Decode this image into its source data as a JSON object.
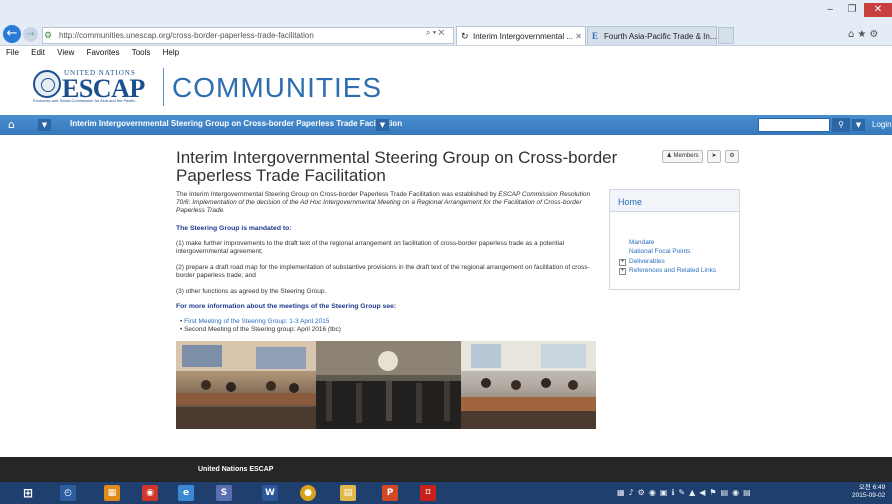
{
  "browser": {
    "address": "http://communities.unescap.org/cross-border-paperless-trade-facilitation",
    "address_controls": "⌕ ▾ ✕",
    "tabs": [
      {
        "label": "Interim Intergovernmental ...",
        "active": true
      },
      {
        "label": "Fourth Asia-Pacific Trade & In...",
        "active": false
      }
    ],
    "menu": [
      "File",
      "Edit",
      "View",
      "Favorites",
      "Tools",
      "Help"
    ]
  },
  "site": {
    "un_label": "UNITED NATIONS",
    "brand": "ESCAP",
    "brand_sub": "Economic and Social Commission for Asia and the Pacific",
    "title": "COMMUNITIES"
  },
  "nav": {
    "breadcrumb": "Interim Intergovernmental Steering Group on Cross-border Paperless Trade Facilitation",
    "login": "Login"
  },
  "page": {
    "title": "Interim Intergovernmental Steering Group on Cross-border Paperless Trade Facilitation",
    "members_button": "Members",
    "intro_plain": "The Interim Intergovernmental Steering Group on Cross-border Paperless Trade Facilitation was established by ",
    "intro_em": "ESCAP Commission Resolution 70/6: Implementation of the decision of the Ad Hoc Intergovernmental Meeting on a Regional Arrangement for the Facilitation of Cross-border Paperless Trade.",
    "mandate_heading": "The Steering Group is mandated to:",
    "mandates": [
      "(1) make further improvements to the draft text of the regional arrangement on facilitation of cross-border paperless trade as a potential intergovernmental agreement;",
      "(2) prepare a draft road map for the implementation of substantive provisions in the draft text of the regional arrangement on facilitation of cross-border paperless trade; and",
      "(3) other functions as agreed by the Steering Group."
    ],
    "meetings_heading": "For more information about the meetings of the Steering Group see:",
    "meetings": [
      {
        "label": "First Meeting of the Steering Group: 1-3 April 2015",
        "link": true
      },
      {
        "label": "Second Meeting of the Steering group: April 2016 (tbc)",
        "link": false
      }
    ]
  },
  "sidebar": {
    "home": "Home",
    "items": [
      {
        "label": "Mandate",
        "expandable": false
      },
      {
        "label": "National Focal Points",
        "expandable": false
      },
      {
        "label": "Deliverables",
        "expandable": true
      },
      {
        "label": "References and Related Links",
        "expandable": true
      }
    ]
  },
  "footer": {
    "text": "United Nations ESCAP"
  },
  "taskbar": {
    "time": "오전 6:49",
    "date": "2015-09-02"
  },
  "colors": {
    "accent": "#2d6eb0",
    "nav": "#3578bc",
    "link": "#2a6fbd",
    "heading": "#1c3a8f",
    "footer": "#262626",
    "taskbar": "#1f3f6f"
  }
}
